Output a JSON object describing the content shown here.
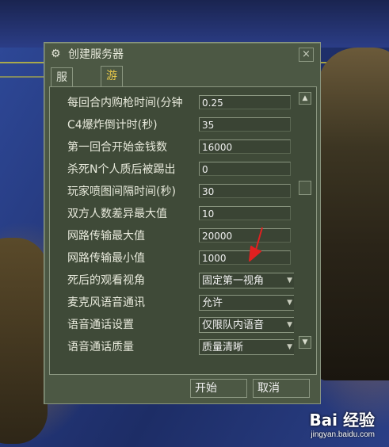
{
  "dialog": {
    "title": "创建服务器",
    "close_label": "×",
    "tabs": [
      {
        "label": "服务器",
        "active": false
      },
      {
        "label": "游戏",
        "active": true
      }
    ],
    "rows": [
      {
        "label": "每回合内购枪时间(分钟",
        "value": "0.25",
        "type": "input"
      },
      {
        "label": "C4爆炸倒计时(秒)",
        "value": "35",
        "type": "input"
      },
      {
        "label": "第一回合开始金钱数",
        "value": "16000",
        "type": "input"
      },
      {
        "label": "杀死N个人质后被踢出",
        "value": "0",
        "type": "input"
      },
      {
        "label": "玩家喷图间隔时间(秒)",
        "value": "30",
        "type": "input"
      },
      {
        "label": "双方人数差异最大值",
        "value": "10",
        "type": "input"
      },
      {
        "label": "网路传输最大值",
        "value": "20000",
        "type": "input"
      },
      {
        "label": "网路传输最小值",
        "value": "1000",
        "type": "input"
      },
      {
        "label": "死后的观看视角",
        "value": "固定第一视角",
        "type": "select"
      },
      {
        "label": "麦克风语音通讯",
        "value": "允许",
        "type": "select"
      },
      {
        "label": "语音通话设置",
        "value": "仅限队内语音",
        "type": "select"
      },
      {
        "label": "语音通话质量",
        "value": "质量清晰",
        "type": "select"
      }
    ],
    "start_label": "开始",
    "cancel_label": "取消"
  },
  "watermark": {
    "logo": "Bai 经验",
    "url": "jingyan.baidu.com"
  },
  "colors": {
    "panel": "#4c5844",
    "border": "#8a9680",
    "active_tab_text": "#e6c84a",
    "annotation_arrow": "#e02020"
  }
}
